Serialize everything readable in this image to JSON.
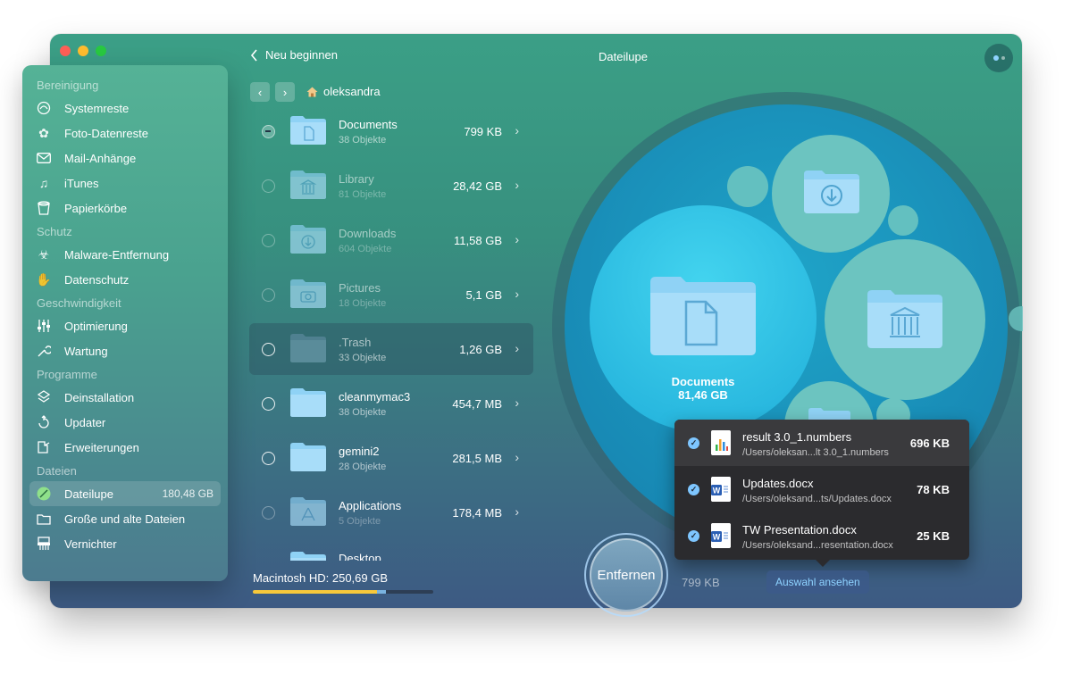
{
  "window": {
    "title": "Dateilupe",
    "back_label": "Neu beginnen"
  },
  "sidebar": {
    "sections": [
      {
        "label": "Bereinigung",
        "items": [
          {
            "label": "Systemreste",
            "icon": "systemreste-icon"
          },
          {
            "label": "Foto-Datenreste",
            "icon": "foto-icon"
          },
          {
            "label": "Mail-Anhänge",
            "icon": "mail-icon"
          },
          {
            "label": "iTunes",
            "icon": "music-icon"
          },
          {
            "label": "Papierkörbe",
            "icon": "trash-icon"
          }
        ]
      },
      {
        "label": "Schutz",
        "items": [
          {
            "label": "Malware-Entfernung",
            "icon": "biohazard-icon"
          },
          {
            "label": "Datenschutz",
            "icon": "hand-icon"
          }
        ]
      },
      {
        "label": "Geschwindigkeit",
        "items": [
          {
            "label": "Optimierung",
            "icon": "sliders-icon"
          },
          {
            "label": "Wartung",
            "icon": "wrench-icon"
          }
        ]
      },
      {
        "label": "Programme",
        "items": [
          {
            "label": "Deinstallation",
            "icon": "uninstall-icon"
          },
          {
            "label": "Updater",
            "icon": "updater-icon"
          },
          {
            "label": "Erweiterungen",
            "icon": "extensions-icon"
          }
        ]
      },
      {
        "label": "Dateien",
        "items": [
          {
            "label": "Dateilupe",
            "icon": "space-lens-icon",
            "size": "180,48 GB"
          },
          {
            "label": "Große und alte Dateien",
            "icon": "folder-icon"
          },
          {
            "label": "Vernichter",
            "icon": "shredder-icon"
          }
        ]
      }
    ]
  },
  "breadcrumb": {
    "label": "oleksandra",
    "icon": "home-icon"
  },
  "files": [
    {
      "name": "Documents",
      "count": "38 Objekte",
      "size": "799 KB",
      "glyph": "document"
    },
    {
      "name": "Library",
      "count": "81 Objekte",
      "size": "28,42 GB",
      "glyph": "library"
    },
    {
      "name": "Downloads",
      "count": "604 Objekte",
      "size": "11,58 GB",
      "glyph": "download"
    },
    {
      "name": "Pictures",
      "count": "18 Objekte",
      "size": "5,1 GB",
      "glyph": "camera"
    },
    {
      "name": ".Trash",
      "count": "33 Objekte",
      "size": "1,26 GB",
      "glyph": "none"
    },
    {
      "name": "cleanmymac3",
      "count": "38 Objekte",
      "size": "454,7 MB",
      "glyph": "none"
    },
    {
      "name": "gemini2",
      "count": "28 Objekte",
      "size": "281,5 MB",
      "glyph": "none"
    },
    {
      "name": "Applications",
      "count": "5 Objekte",
      "size": "178,4 MB",
      "glyph": "apps"
    },
    {
      "name": "Desktop",
      "count": "",
      "size": "",
      "glyph": "none"
    }
  ],
  "disk": {
    "label": "Macintosh HD: 250,69 GB",
    "used_fraction": 0.69,
    "selected_fraction": 0.05
  },
  "bubble_chart": {
    "focus_name": "Documents",
    "focus_size": "81,46 GB"
  },
  "selection_popup": {
    "items": [
      {
        "name": "result 3.0_1.numbers",
        "path": "/Users/oleksan...lt 3.0_1.numbers",
        "size": "696 KB",
        "type": "numbers"
      },
      {
        "name": "Updates.docx",
        "path": "/Users/oleksand...ts/Updates.docx",
        "size": "78 KB",
        "type": "word"
      },
      {
        "name": "TW Presentation.docx",
        "path": "/Users/oleksand...resentation.docx",
        "size": "25 KB",
        "type": "word"
      }
    ]
  },
  "actions": {
    "remove_label": "Entfernen",
    "selected_size": "799 KB",
    "review_label": "Auswahl ansehen"
  }
}
